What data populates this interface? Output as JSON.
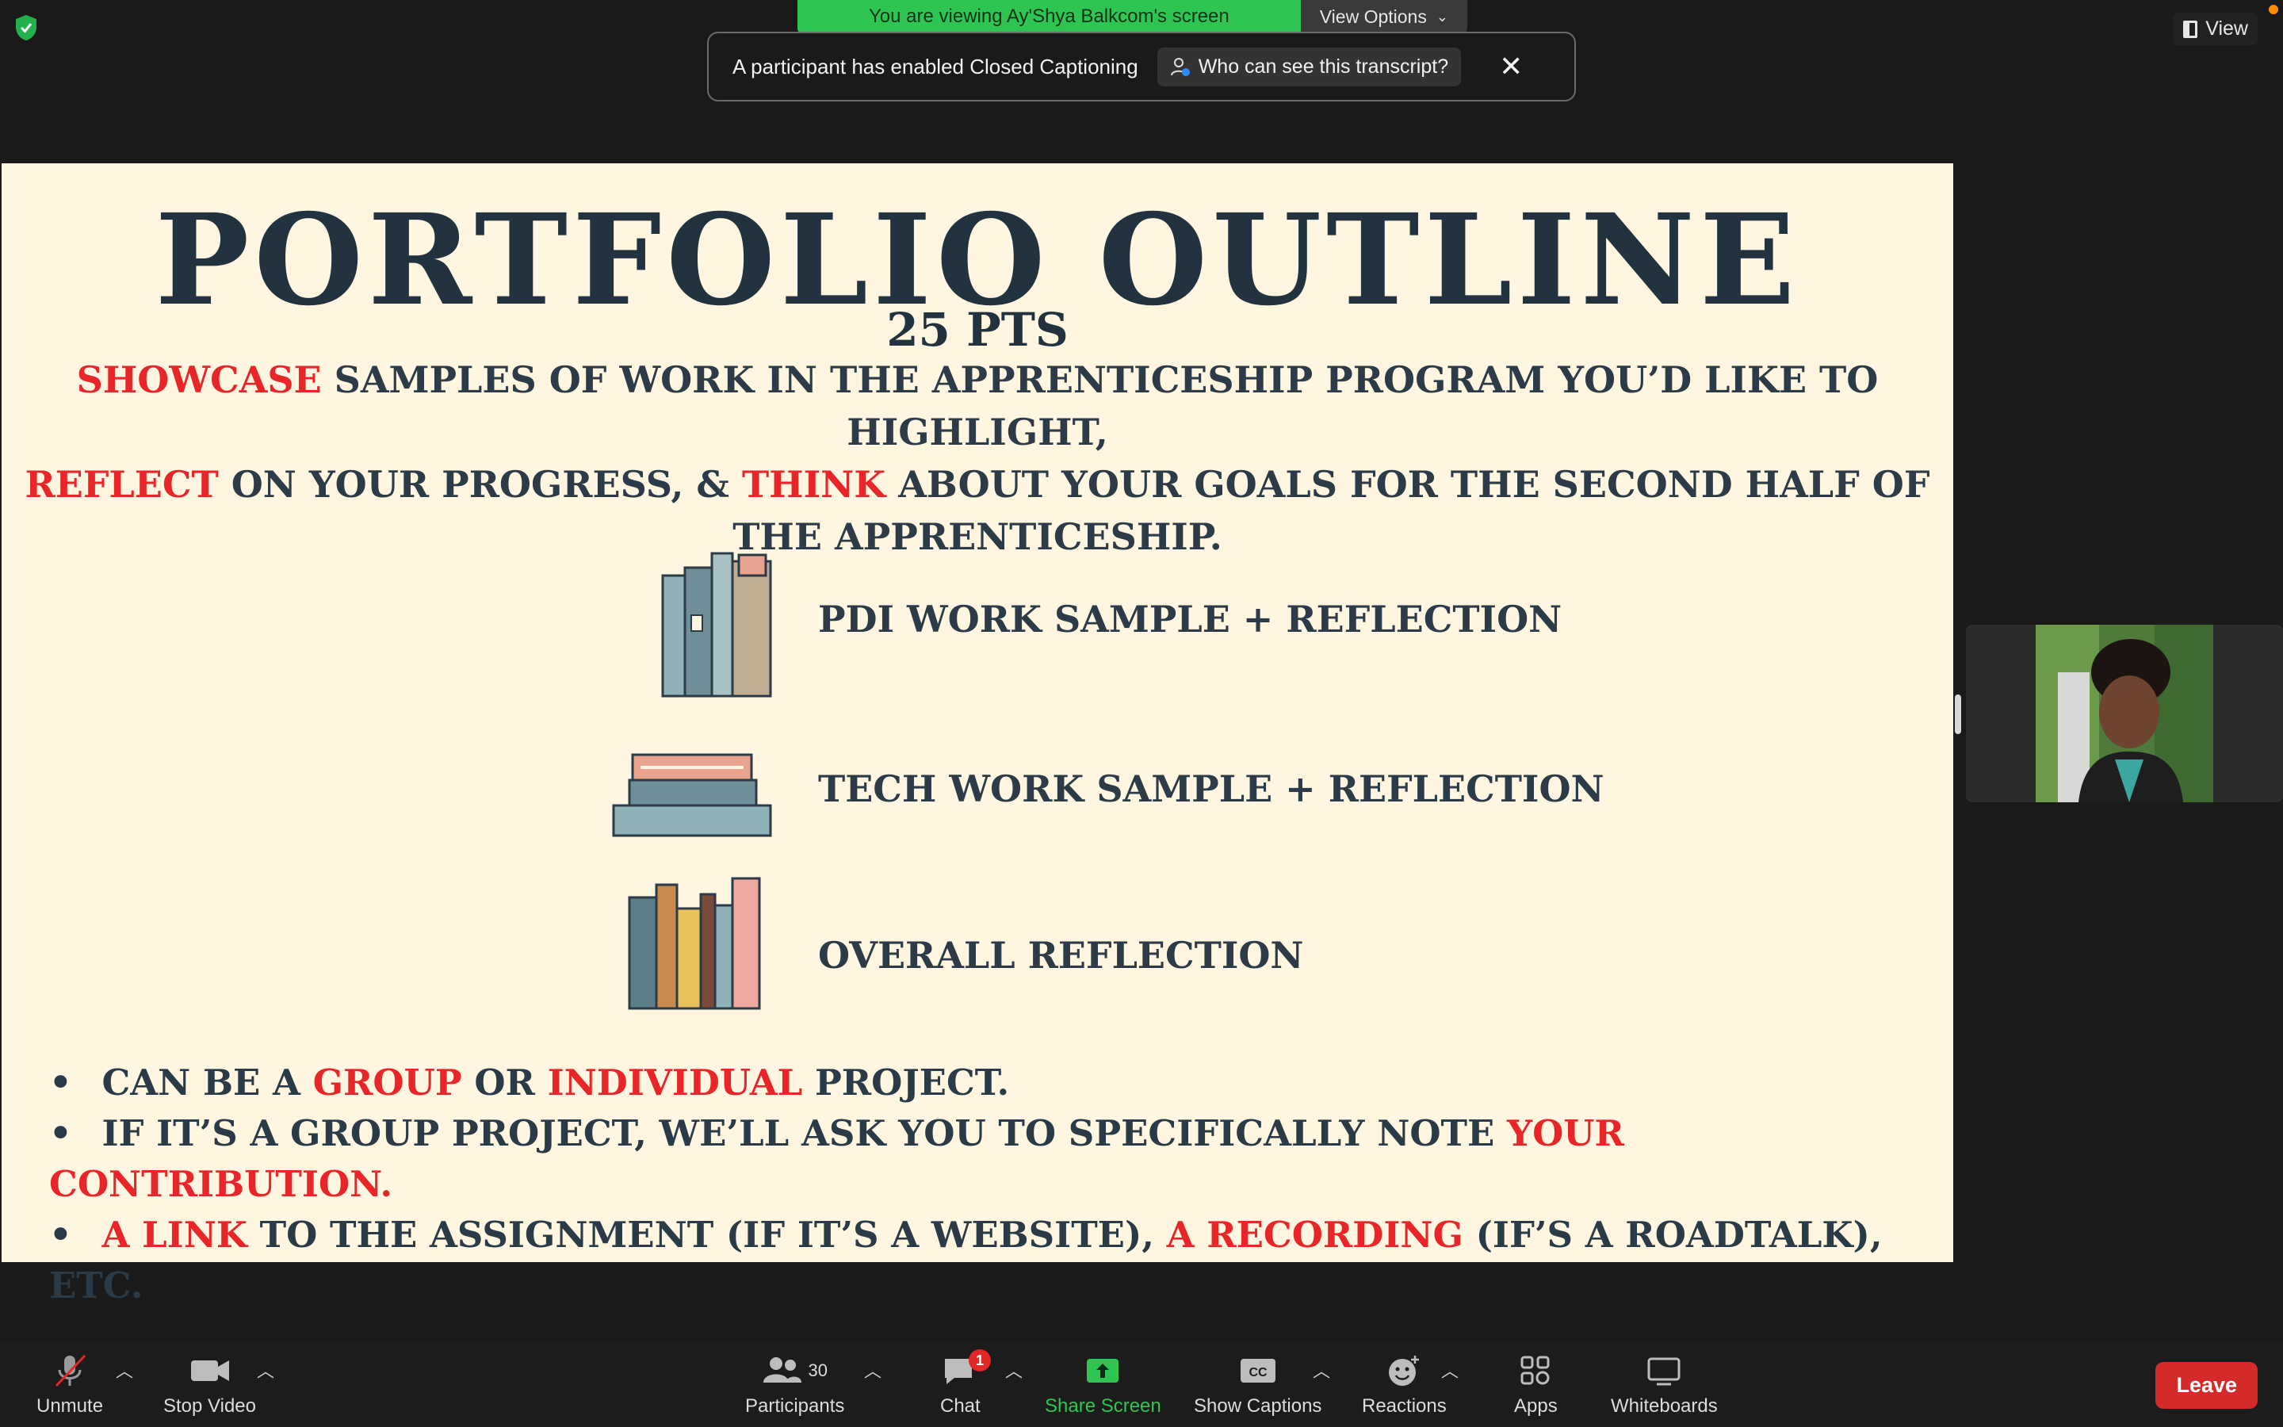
{
  "top": {
    "share_banner": "You are viewing Ay'Shya Balkcom's screen",
    "view_options": "View Options",
    "view_label": "View"
  },
  "cc_toast": {
    "message": "A participant has enabled Closed Captioning",
    "who_button": "Who can see this transcript?"
  },
  "slide": {
    "title": "PORTFOLIO OUTLINE",
    "points": "25 PTS",
    "intro": {
      "w1": "SHOWCASE",
      "t1": " SAMPLES OF  WORK IN THE APPRENTICESHIP PROGRAM YOU’D LIKE TO HIGHLIGHT,",
      "w2": "REFLECT",
      "t2": " ON YOUR PROGRESS, & ",
      "w3": "THINK",
      "t3": " ABOUT YOUR GOALS FOR THE SECOND HALF OF THE APPRENTICESHIP."
    },
    "items": [
      "PDI WORK SAMPLE + REFLECTION",
      "TECH WORK SAMPLE + REFLECTION",
      "OVERALL REFLECTION"
    ],
    "bullets": {
      "b1_a": "CAN BE A ",
      "b1_r1": "GROUP",
      "b1_b": " OR ",
      "b1_r2": "INDIVIDUAL",
      "b1_c": " PROJECT.",
      "b2_a": "IF IT’S A GROUP PROJECT, WE’LL ASK YOU TO SPECIFICALLY NOTE ",
      "b2_r": "YOUR CONTRIBUTION.",
      "b3_r1": "A LINK",
      "b3_a": " TO THE ASSIGNMENT (IF IT’S A WEBSITE), ",
      "b3_r2": "A RECORDING",
      "b3_b": " (IF’S A ROADTALK), ETC."
    }
  },
  "toolbar": {
    "unmute": "Unmute",
    "stop_video": "Stop Video",
    "participants": "Participants",
    "participant_count": "30",
    "chat": "Chat",
    "chat_badge": "1",
    "share_screen": "Share Screen",
    "captions_icon_text": "CC",
    "show_captions": "Show Captions",
    "reactions": "Reactions",
    "apps": "Apps",
    "whiteboards": "Whiteboards",
    "leave": "Leave"
  },
  "colors": {
    "slide_bg": "#fff6e1",
    "slide_text": "#2a3a47",
    "accent_red": "#e8262a",
    "share_green": "#2ec552",
    "leave_red": "#d42a2a"
  }
}
